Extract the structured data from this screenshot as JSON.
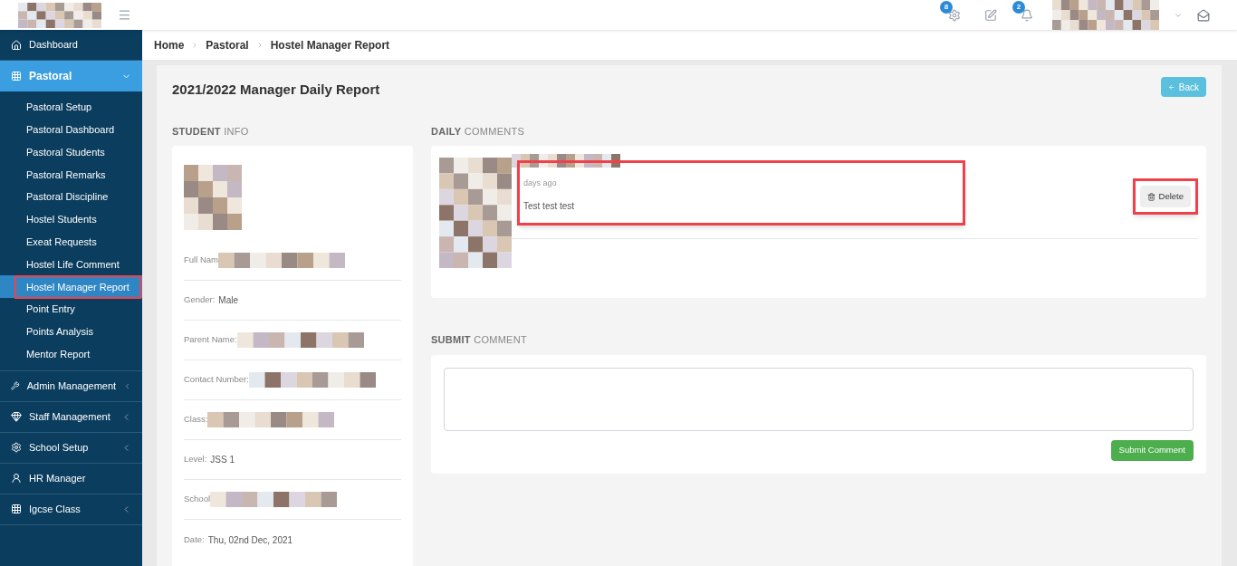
{
  "header": {
    "badges": [
      {
        "kind": "settings",
        "count": "8"
      },
      {
        "kind": "edit"
      },
      {
        "kind": "bell",
        "count": "2"
      }
    ]
  },
  "sidebar": {
    "items": [
      {
        "label": "Dashboard",
        "selected": false
      },
      {
        "label": "Pastoral",
        "selected": true,
        "expanded": true,
        "children": [
          {
            "label": "Pastoral Setup",
            "selected": false,
            "highlighted": false
          },
          {
            "label": "Pastoral Dashboard",
            "selected": false,
            "highlighted": false
          },
          {
            "label": "Pastoral Students",
            "selected": false,
            "highlighted": false
          },
          {
            "label": "Pastoral Remarks",
            "selected": false,
            "highlighted": false
          },
          {
            "label": "Pastoral Discipline",
            "selected": false,
            "highlighted": false
          },
          {
            "label": "Hostel Students",
            "selected": false,
            "highlighted": false
          },
          {
            "label": "Exeat Requests",
            "selected": false,
            "highlighted": false
          },
          {
            "label": "Hostel Life Comment",
            "selected": false,
            "highlighted": false
          },
          {
            "label": "Hostel Manager Report",
            "selected": true,
            "highlighted": true
          },
          {
            "label": "Point Entry",
            "selected": false,
            "highlighted": false
          },
          {
            "label": "Points Analysis",
            "selected": false,
            "highlighted": false
          },
          {
            "label": "Mentor Report",
            "selected": false,
            "highlighted": false
          }
        ]
      },
      {
        "label": "Admin Management",
        "selected": false,
        "expanded": false
      },
      {
        "label": "Staff Management",
        "selected": false,
        "expanded": false
      },
      {
        "label": "School Setup",
        "selected": false,
        "expanded": false
      },
      {
        "label": "HR Manager",
        "selected": false
      },
      {
        "label": "Igcse Class",
        "selected": false,
        "expanded": false
      }
    ]
  },
  "breadcrumb": [
    "Home",
    "Pastoral",
    "Hostel Manager Report"
  ],
  "page": {
    "title": "2021/2022 Manager Daily Report",
    "back_button": "Back"
  },
  "student_info": {
    "heading_bold": "STUDENT",
    "heading_light": "INFO",
    "rows": [
      {
        "label": "Full Nam",
        "redacted": true
      },
      {
        "label": "Gender:",
        "value": "Male"
      },
      {
        "label": "Parent Name:",
        "redacted": true
      },
      {
        "label": "Contact Number:",
        "redacted": true
      },
      {
        "label": "Class:",
        "redacted": true
      },
      {
        "label": "Level:",
        "value": "JSS 1"
      },
      {
        "label": "School",
        "redacted": true
      },
      {
        "label": "Date:",
        "value": "Thu, 02nd Dec, 2021"
      }
    ]
  },
  "daily_comments": {
    "heading_bold": "DAILY",
    "heading_light": "COMMENTS",
    "comments": [
      {
        "time": "days ago",
        "text": "Test test test",
        "highlighted": true,
        "delete_button": "Delete",
        "delete_highlighted": true
      }
    ]
  },
  "submit_comment": {
    "heading_bold": "SUBMIT",
    "heading_light": "COMMENT",
    "button": "Submit Comment"
  }
}
